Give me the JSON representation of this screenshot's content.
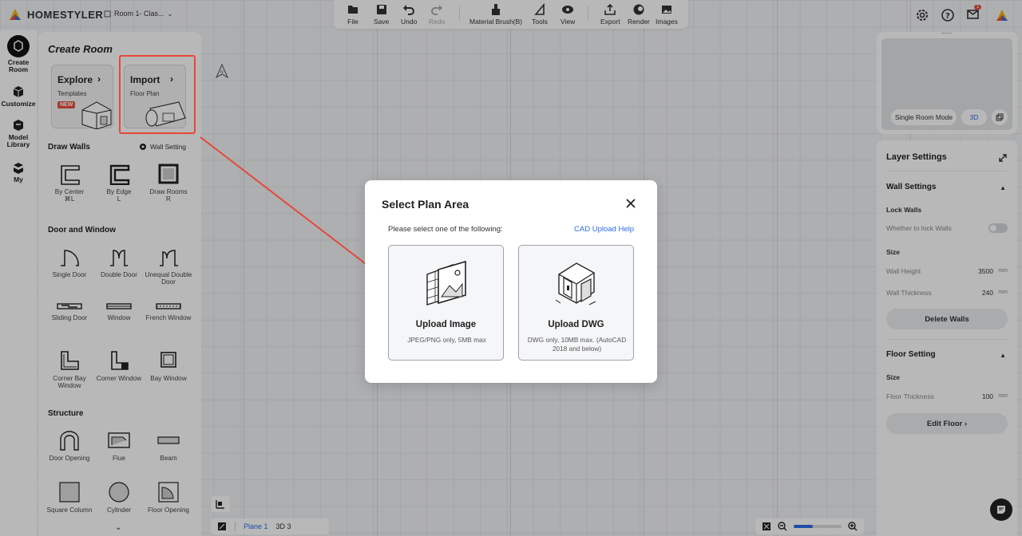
{
  "app": {
    "brand": "HOMESTYLER",
    "room_name": "Room 1- Clas...",
    "notification_count": "1"
  },
  "toolbar": {
    "file": "File",
    "save": "Save",
    "undo": "Undo",
    "redo": "Redo",
    "material_brush": "Material Brush(B)",
    "tools": "Tools",
    "view": "View",
    "export": "Export",
    "render": "Render",
    "images": "Images"
  },
  "rail": {
    "create_room": "Create Room",
    "customize": "Customize",
    "model_library": "Model Library",
    "my": "My"
  },
  "panel": {
    "title": "Create Room",
    "explore": {
      "title": "Explore",
      "subtitle": "Templates",
      "badge": "NEW"
    },
    "import": {
      "title": "Import",
      "subtitle": "Floor Plan"
    },
    "draw_walls": "Draw Walls",
    "wall_setting": "Wall Setting",
    "wall_tools": [
      {
        "label": "By Center",
        "shortcut": "⌘L"
      },
      {
        "label": "By Edge",
        "shortcut": "L"
      },
      {
        "label": "Draw Rooms",
        "shortcut": "R"
      }
    ],
    "door_window": "Door and Window",
    "doors": [
      "Single Door",
      "Double Door",
      "Unequal Double Door",
      "Sliding Door",
      "Window",
      "French Window",
      "Corner Bay Window",
      "Corner Window",
      "Bay Window"
    ],
    "structure": "Structure",
    "structures": [
      "Door Opening",
      "Flue",
      "Beam",
      "Square Column",
      "Cylinder",
      "Floor Opening"
    ]
  },
  "preview": {
    "single_room_mode": "Single Room Mode",
    "mode_3d": "3D"
  },
  "layers": {
    "title": "Layer Settings",
    "wall_settings": "Wall Settings",
    "lock_walls": "Lock Walls",
    "lock_walls_desc": "Whether to lock Walls",
    "size": "Size",
    "wall_height_label": "Wall Height",
    "wall_height": "3500",
    "wall_thickness_label": "Wall Thickness",
    "wall_thickness": "240",
    "unit": "mm",
    "delete_walls": "Delete Walls",
    "floor_setting": "Floor Setting",
    "floor_size": "Size",
    "floor_thickness_label": "Floor Thickness",
    "floor_thickness": "100",
    "edit_floor": "Edit Floor ›"
  },
  "bottom": {
    "plane": "Plane 1",
    "view3d": "3D 3"
  },
  "modal": {
    "title": "Select Plan Area",
    "subtitle": "Please select one of the following:",
    "help_link": "CAD Upload Help",
    "upload_image": {
      "title": "Upload Image",
      "desc": "JPEG/PNG only, 5MB max"
    },
    "upload_dwg": {
      "title": "Upload DWG",
      "desc": "DWG only, 10MB max. (AutoCAD 2018 and below)"
    }
  },
  "colors": {
    "highlight": "#e8473a",
    "link": "#2e6be6",
    "badge": "#e84f3d"
  }
}
